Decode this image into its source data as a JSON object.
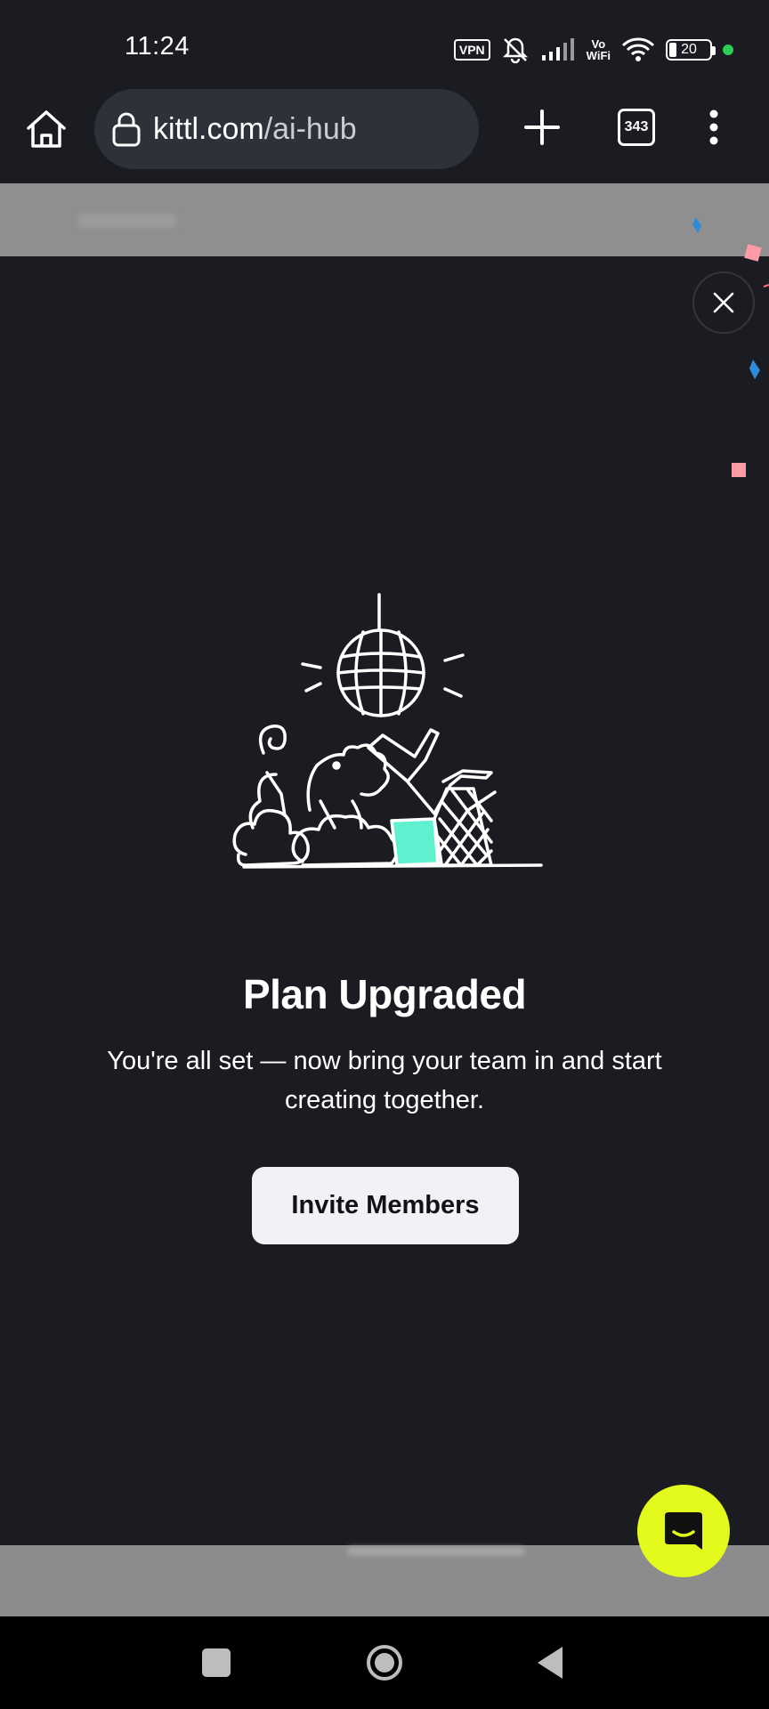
{
  "status_bar": {
    "time": "11:24",
    "vpn_label": "VPN",
    "vowifi_top": "Vo",
    "vowifi_bottom": "WiFi",
    "battery_level": "20",
    "indicator_color": "#2ecc55"
  },
  "browser": {
    "url_domain": "kittl.com",
    "url_path": "/ai-hub",
    "tab_count": "343",
    "icons": [
      "home-icon",
      "lock-icon",
      "plus-icon",
      "tabs-icon",
      "more-vert-icon"
    ]
  },
  "modal": {
    "title": "Plan Upgraded",
    "body": "You're all set — now bring your team in and start creating together.",
    "cta_label": "Invite Members",
    "illustration": "disco-party-illustration",
    "accent_color": "#5ff0d0"
  },
  "chat": {
    "icon": "chat-icon",
    "color": "#e4fa1c"
  },
  "nav": {
    "icons": [
      "recents-icon",
      "home-circle-icon",
      "back-icon"
    ]
  }
}
